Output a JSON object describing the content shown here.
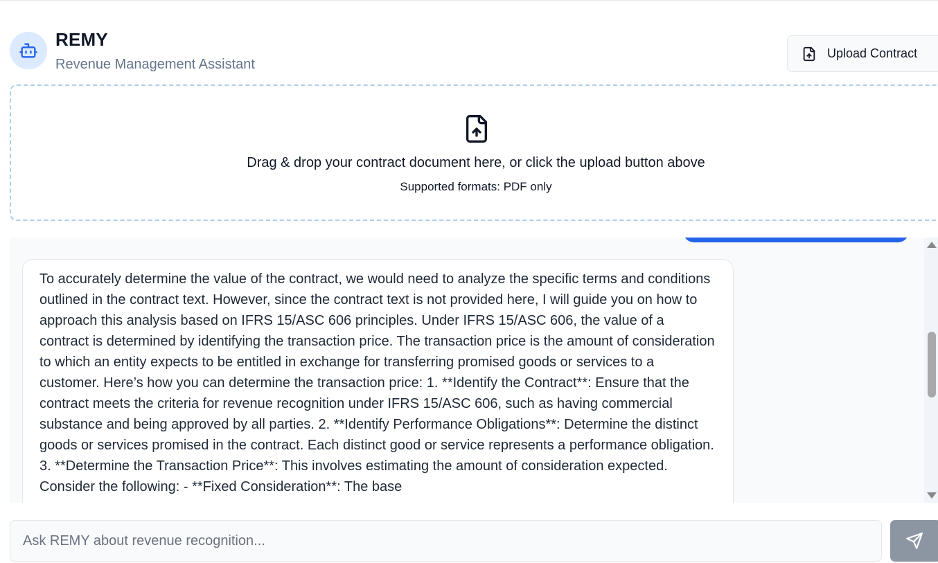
{
  "header": {
    "title": "REMY",
    "subtitle": "Revenue Management Assistant",
    "avatar_icon": "bot-icon",
    "upload_button": {
      "label": "Upload Contract",
      "icon": "file-upload-icon"
    }
  },
  "dropzone": {
    "icon": "file-upload-icon",
    "instruction": "Drag & drop your contract document here, or click the upload button above",
    "formats": "Supported formats: PDF only"
  },
  "chat": {
    "messages": [
      {
        "role": "assistant",
        "text": "To accurately determine the value of the contract, we would need to analyze the specific terms and conditions outlined in the contract text. However, since the contract text is not provided here, I will guide you on how to approach this analysis based on IFRS 15/ASC 606 principles. Under IFRS 15/ASC 606, the value of a contract is determined by identifying the transaction price. The transaction price is the amount of consideration to which an entity expects to be entitled in exchange for transferring promised goods or services to a customer. Here’s how you can determine the transaction price: 1. **Identify the Contract**: Ensure that the contract meets the criteria for revenue recognition under IFRS 15/ASC 606, such as having commercial substance and being approved by all parties. 2. **Identify Performance Obligations**: Determine the distinct goods or services promised in the contract. Each distinct good or service represents a performance obligation. 3. **Determine the Transaction Price**: This involves estimating the amount of consideration expected. Consider the following: - **Fixed Consideration**: The base"
      }
    ]
  },
  "composer": {
    "placeholder": "Ask REMY about revenue recognition...",
    "value": "",
    "send_icon": "send-icon"
  },
  "colors": {
    "accent": "#2563eb",
    "avatar_bg": "#dbeafe",
    "dropzone_border": "#a9d0ec",
    "send_button": "#8c96a3"
  }
}
